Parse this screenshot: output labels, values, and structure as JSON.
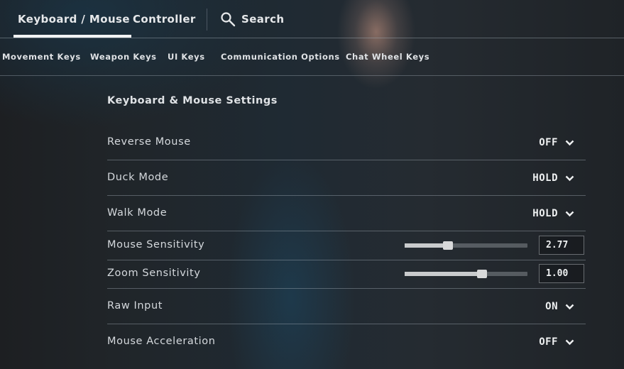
{
  "top_tabs": [
    {
      "label": "Keyboard / Mouse",
      "active": true
    },
    {
      "label": "Controller",
      "active": false
    }
  ],
  "search": {
    "label": "Search",
    "icon": "search-icon"
  },
  "sub_tabs": [
    {
      "label": "Movement Keys"
    },
    {
      "label": "Weapon Keys"
    },
    {
      "label": "UI Keys"
    },
    {
      "label": "Communication Options"
    },
    {
      "label": "Chat Wheel Keys"
    }
  ],
  "section": {
    "title": "Keyboard & Mouse Settings"
  },
  "settings": {
    "reverse_mouse": {
      "label": "Reverse Mouse",
      "value": "OFF"
    },
    "duck_mode": {
      "label": "Duck Mode",
      "value": "HOLD"
    },
    "walk_mode": {
      "label": "Walk Mode",
      "value": "HOLD"
    },
    "mouse_sensitivity": {
      "label": "Mouse Sensitivity",
      "value": "2.77",
      "slider_fraction": 0.35
    },
    "zoom_sensitivity": {
      "label": "Zoom Sensitivity",
      "value": "1.00",
      "slider_fraction": 0.63
    },
    "raw_input": {
      "label": "Raw Input",
      "value": "ON"
    },
    "mouse_acceleration": {
      "label": "Mouse Acceleration",
      "value": "OFF"
    }
  },
  "icons": {
    "dropdown": "chevron-down-icon"
  }
}
